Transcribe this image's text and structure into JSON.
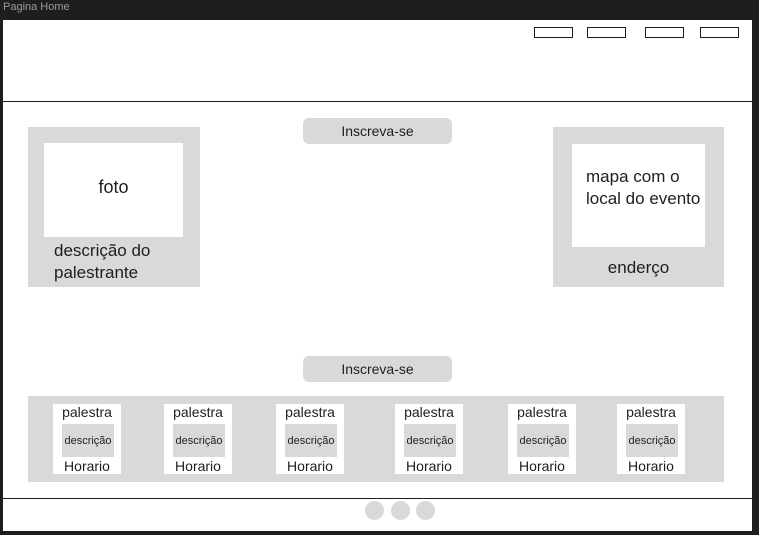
{
  "frame_title": "Pagina Home",
  "header": {
    "nav_buttons": [
      "",
      "",
      "",
      ""
    ]
  },
  "cta_top": "Inscreva-se",
  "cta_bottom": "Inscreva-se",
  "speaker": {
    "photo_label": "foto",
    "description": "descrição do palestrante"
  },
  "location": {
    "map_label": "mapa com o local do evento",
    "address_label": "enderço"
  },
  "talks": [
    {
      "title": "palestra",
      "description": "descrição",
      "time": "Horario"
    },
    {
      "title": "palestra",
      "description": "descrição",
      "time": "Horario"
    },
    {
      "title": "palestra",
      "description": "descrição",
      "time": "Horario"
    },
    {
      "title": "palestra",
      "description": "descrição",
      "time": "Horario"
    },
    {
      "title": "palestra",
      "description": "descrição",
      "time": "Horario"
    },
    {
      "title": "palestra",
      "description": "descrição",
      "time": "Horario"
    }
  ],
  "footer": {
    "dots": 3
  },
  "colors": {
    "stroke": "#1e1e1e",
    "fill": "#d9d9d9",
    "background": "#ffffff",
    "canvas": "#1e1e1e"
  }
}
